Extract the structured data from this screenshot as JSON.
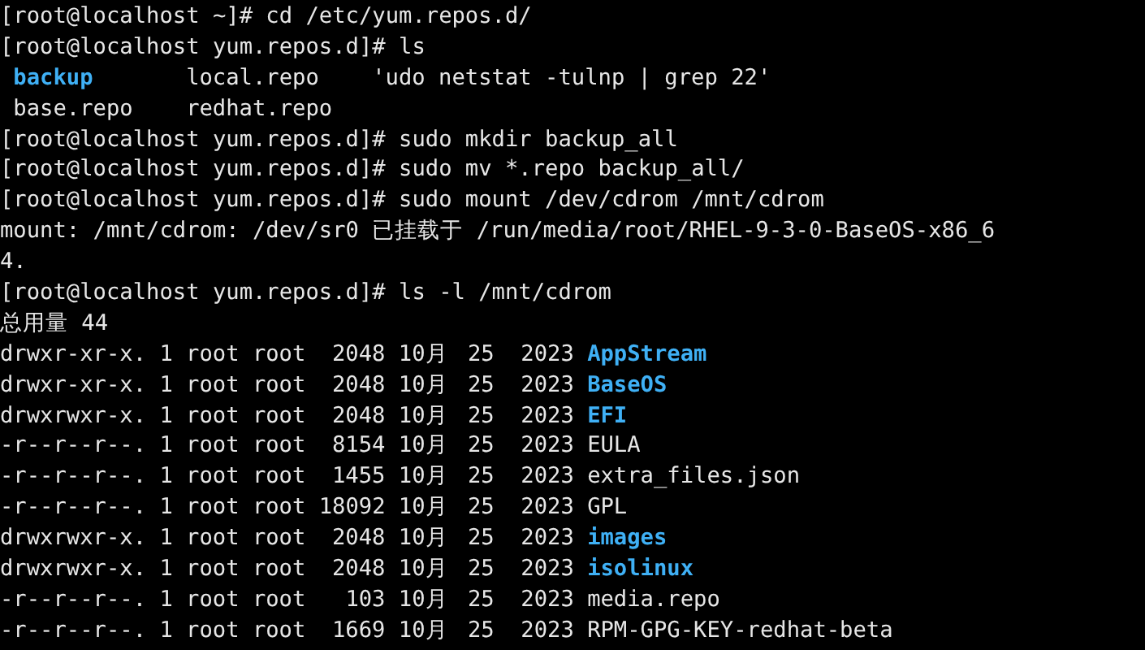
{
  "terminal": {
    "lines": [
      {
        "kind": "prompt",
        "prompt": "[root@localhost ~]#",
        "command": "cd /etc/yum.repos.d/"
      },
      {
        "kind": "prompt",
        "prompt": "[root@localhost yum.repos.d]#",
        "command": "ls"
      },
      {
        "kind": "ls",
        "rows": [
          [
            {
              "name": "backup",
              "kind": "directory"
            },
            {
              "name": "local.repo",
              "kind": "file"
            },
            {
              "name": "'udo netstat -tulnp | grep 22'",
              "kind": "file"
            }
          ],
          [
            {
              "name": "base.repo",
              "kind": "file"
            },
            {
              "name": "redhat.repo",
              "kind": "file"
            }
          ]
        ]
      },
      {
        "kind": "prompt",
        "prompt": "[root@localhost yum.repos.d]#",
        "command": "sudo mkdir backup_all"
      },
      {
        "kind": "prompt",
        "prompt": "[root@localhost yum.repos.d]#",
        "command": "sudo mv *.repo backup_all/"
      },
      {
        "kind": "prompt",
        "prompt": "[root@localhost yum.repos.d]#",
        "command": "sudo mount /dev/cdrom /mnt/cdrom"
      },
      {
        "kind": "output",
        "text": "mount: /mnt/cdrom: /dev/sr0 已挂载于 /run/media/root/RHEL-9-3-0-BaseOS-x86_6"
      },
      {
        "kind": "output",
        "text": "4."
      },
      {
        "kind": "prompt",
        "prompt": "[root@localhost yum.repos.d]#",
        "command": "ls -l /mnt/cdrom"
      },
      {
        "kind": "output",
        "text": "总用量 44"
      },
      {
        "kind": "listing",
        "rows": [
          {
            "perms": "drwxr-xr-x.",
            "links": "1",
            "owner": "root",
            "group": "root",
            "size": "2048",
            "month": "10月",
            "day": "25",
            "year": "2023",
            "name": "AppStream",
            "kind": "directory"
          },
          {
            "perms": "drwxr-xr-x.",
            "links": "1",
            "owner": "root",
            "group": "root",
            "size": "2048",
            "month": "10月",
            "day": "25",
            "year": "2023",
            "name": "BaseOS",
            "kind": "directory"
          },
          {
            "perms": "drwxrwxr-x.",
            "links": "1",
            "owner": "root",
            "group": "root",
            "size": "2048",
            "month": "10月",
            "day": "25",
            "year": "2023",
            "name": "EFI",
            "kind": "directory"
          },
          {
            "perms": "-r--r--r--.",
            "links": "1",
            "owner": "root",
            "group": "root",
            "size": "8154",
            "month": "10月",
            "day": "25",
            "year": "2023",
            "name": "EULA",
            "kind": "file"
          },
          {
            "perms": "-r--r--r--.",
            "links": "1",
            "owner": "root",
            "group": "root",
            "size": "1455",
            "month": "10月",
            "day": "25",
            "year": "2023",
            "name": "extra_files.json",
            "kind": "file"
          },
          {
            "perms": "-r--r--r--.",
            "links": "1",
            "owner": "root",
            "group": "root",
            "size": "18092",
            "month": "10月",
            "day": "25",
            "year": "2023",
            "name": "GPL",
            "kind": "file"
          },
          {
            "perms": "drwxrwxr-x.",
            "links": "1",
            "owner": "root",
            "group": "root",
            "size": "2048",
            "month": "10月",
            "day": "25",
            "year": "2023",
            "name": "images",
            "kind": "directory"
          },
          {
            "perms": "drwxrwxr-x.",
            "links": "1",
            "owner": "root",
            "group": "root",
            "size": "2048",
            "month": "10月",
            "day": "25",
            "year": "2023",
            "name": "isolinux",
            "kind": "directory"
          },
          {
            "perms": "-r--r--r--.",
            "links": "1",
            "owner": "root",
            "group": "root",
            "size": "103",
            "month": "10月",
            "day": "25",
            "year": "2023",
            "name": "media.repo",
            "kind": "file"
          },
          {
            "perms": "-r--r--r--.",
            "links": "1",
            "owner": "root",
            "group": "root",
            "size": "1669",
            "month": "10月",
            "day": "25",
            "year": "2023",
            "name": "RPM-GPG-KEY-redhat-beta",
            "kind": "file"
          }
        ]
      }
    ]
  }
}
